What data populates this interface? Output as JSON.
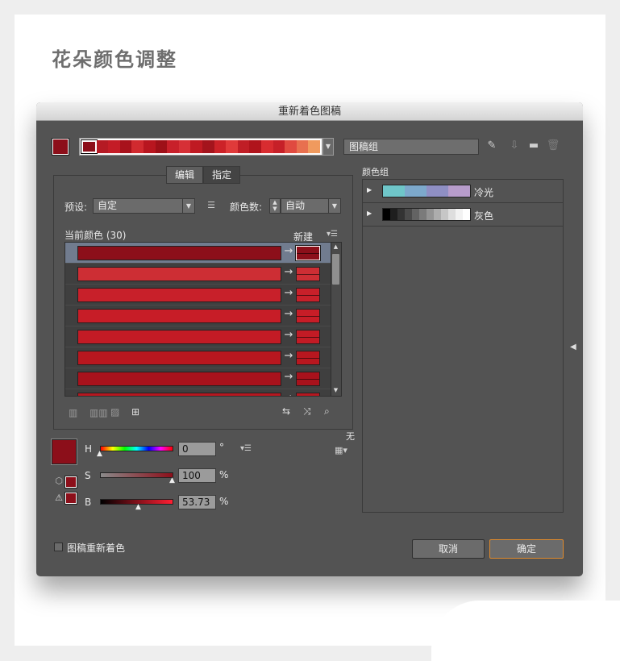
{
  "page": {
    "heading": "花朵颜色调整"
  },
  "dialog": {
    "title": "重新着色图稿",
    "group_name": "图稿组",
    "tabs": [
      "编辑",
      "指定"
    ],
    "preset_label": "预设:",
    "preset_value": "自定",
    "color_count_label": "颜色数:",
    "color_count_value": "自动",
    "current_colors_label": "当前颜色 (30)",
    "new_label": "新建",
    "none_label": "无",
    "recolor_label": "图稿重新着色",
    "cancel": "取消",
    "ok": "确定"
  },
  "harmony_colors": [
    "#8c0f1a",
    "#b51a24",
    "#c41c26",
    "#a8121c",
    "#d12a2f",
    "#b8161f",
    "#9e1018",
    "#c8202a",
    "#d63036",
    "#bf1a22",
    "#a4141c",
    "#cc2228",
    "#e03a3a",
    "#c01e26",
    "#b0141c",
    "#d82c30",
    "#c62028",
    "#e04a40",
    "#e8704f",
    "#f09a5e"
  ],
  "color_rows": [
    {
      "current": "#8c0f1a",
      "new": "#8c0f1a",
      "selected": true
    },
    {
      "current": "#cd2e34",
      "new": "#cd2e34",
      "selected": false
    },
    {
      "current": "#c8202a",
      "new": "#c8202a",
      "selected": false
    },
    {
      "current": "#c71d27",
      "new": "#c71d27",
      "selected": false
    },
    {
      "current": "#c31b25",
      "new": "#c31b25",
      "selected": false
    },
    {
      "current": "#b8171f",
      "new": "#b8171f",
      "selected": false
    },
    {
      "current": "#a8121c",
      "new": "#a8121c",
      "selected": false
    },
    {
      "current": "#b51820",
      "new": "#b51820",
      "selected": false
    }
  ],
  "hsb": {
    "h_label": "H",
    "h_value": "0",
    "h_unit": "°",
    "s_label": "S",
    "s_value": "100",
    "s_unit": "%",
    "b_label": "B",
    "b_value": "53.73",
    "b_unit": "%"
  },
  "color_groups_title": "颜色组",
  "color_groups": [
    {
      "name": "冷光",
      "swatches": [
        "#6fc6c9",
        "#7da9cc",
        "#8f8fc4",
        "#b79ccb"
      ]
    },
    {
      "name": "灰色",
      "swatches": [
        "#000000",
        "#1e1e1e",
        "#333333",
        "#4a4a4a",
        "#636363",
        "#7b7b7b",
        "#949494",
        "#adadad",
        "#c6c6c6",
        "#dedede",
        "#f2f2f2",
        "#ffffff"
      ]
    }
  ],
  "colors": {
    "dialog_bg": "#535353",
    "accent": "#e08a2c",
    "base_red": "#8c0f1a"
  }
}
